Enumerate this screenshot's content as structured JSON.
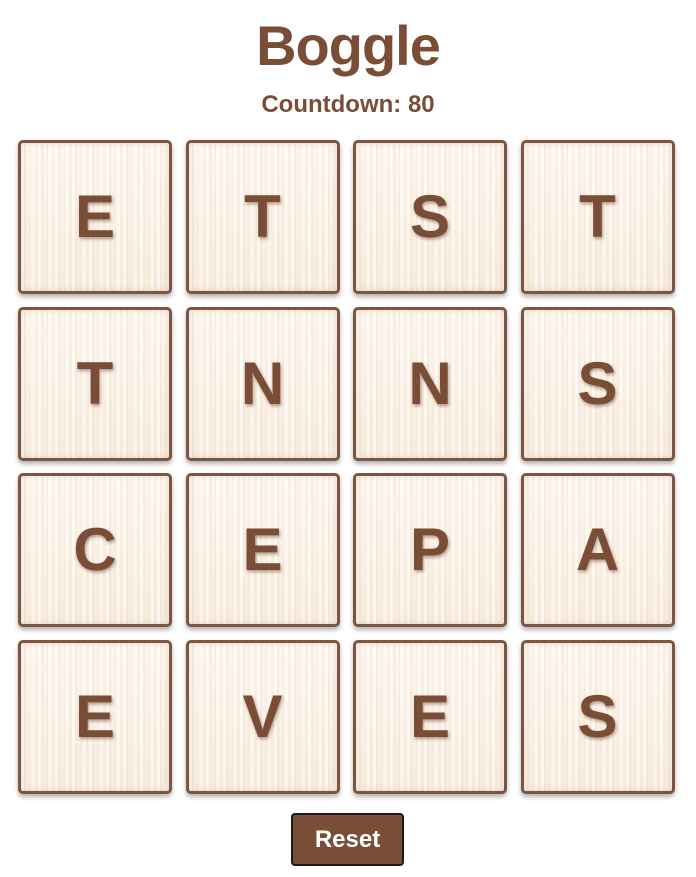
{
  "header": {
    "title": "Boggle",
    "countdown": "Countdown: 80"
  },
  "board": {
    "rows": [
      [
        "E",
        "T",
        "S",
        "T"
      ],
      [
        "T",
        "N",
        "N",
        "S"
      ],
      [
        "C",
        "E",
        "P",
        "A"
      ],
      [
        "E",
        "V",
        "E",
        "S"
      ]
    ]
  },
  "controls": {
    "reset_label": "Reset"
  },
  "colors": {
    "brand_brown": "#7a4e36",
    "tile_border": "#7c5641",
    "tile_face": "#fbf1e6",
    "button_text": "#ffffff"
  }
}
